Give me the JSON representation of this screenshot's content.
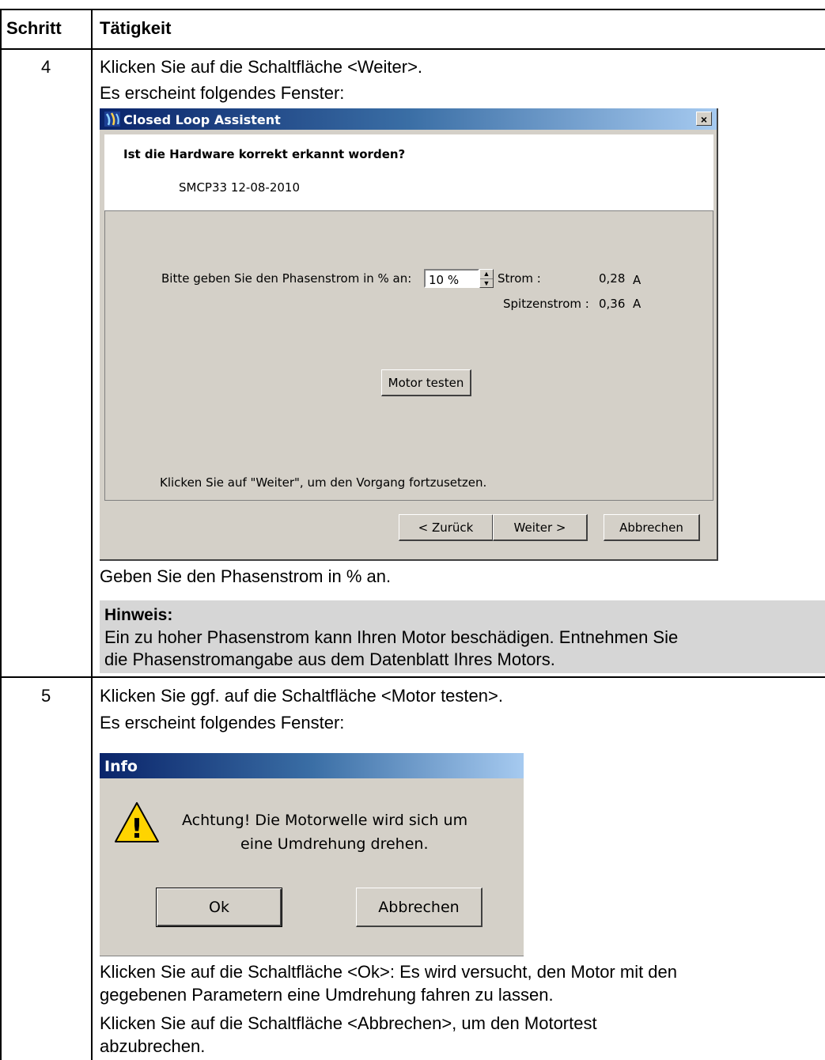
{
  "table": {
    "header_step": "Schritt",
    "header_activity": "Tätigkeit"
  },
  "step4": {
    "number": "4",
    "line1": "Klicken Sie auf die Schaltfläche <Weiter>.",
    "line2": "Es erscheint folgendes Fenster:",
    "after": "Geben Sie den Phasenstrom in % an.",
    "hint_title": "Hinweis:",
    "hint_line1": "Ein zu hoher Phasenstrom kann Ihren  Motor beschädigen. Entnehmen Sie",
    "hint_line2": "die Phasenstromangabe aus dem Datenblatt Ihres Motors."
  },
  "dialog1": {
    "title": "Closed Loop Assistent",
    "close_label": "×",
    "question": "Ist die Hardware korrekt erkannt worden?",
    "hardware": "SMCP33 12-08-2010",
    "phase_label": "Bitte geben Sie den Phasenstrom in % an:",
    "phase_value": "10 %",
    "strom_label": "Strom :",
    "strom_value": "0,28",
    "strom_unit": "A",
    "spitzen_label": "Spitzenstrom :",
    "spitzen_value": "0,36",
    "spitzen_unit": "A",
    "motor_test_button": "Motor testen",
    "continue_hint": "Klicken Sie auf \"Weiter\", um den Vorgang fortzusetzen.",
    "back_button": "< Zurück",
    "next_button": "Weiter >",
    "cancel_button": "Abbrechen"
  },
  "step5": {
    "number": "5",
    "line1": "Klicken Sie ggf. auf die Schaltfläche <Motor testen>.",
    "line2": "Es erscheint folgendes Fenster:",
    "after1": "Klicken Sie auf die Schaltfläche <Ok>: Es wird versucht, den Motor mit den",
    "after2": "gegebenen Parametern eine Umdrehung fahren zu lassen.",
    "after3": "Klicken Sie auf die Schaltfläche <Abbrechen>, um den Motortest",
    "after4": "abzubrechen."
  },
  "dialog2": {
    "title": "Info",
    "message1": "Achtung! Die Motorwelle wird sich um",
    "message2": "eine Umdrehung drehen.",
    "warning_glyph": "!",
    "ok_button": "Ok",
    "cancel_button": "Abbrechen"
  }
}
